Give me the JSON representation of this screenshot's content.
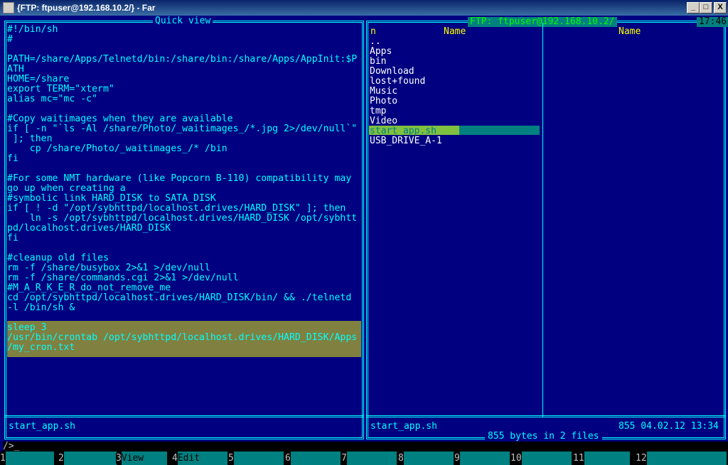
{
  "window": {
    "title": "{FTP: ftpuser@192.168.10.2/} - Far",
    "min": "_",
    "max": "□",
    "close": "X"
  },
  "left_panel": {
    "title": "Quick view",
    "content": "#!/bin/sh\n#\n\nPATH=/share/Apps/Telnetd/bin:/share/bin:/share/Apps/AppInit:$P\nATH\nHOME=/share\nexport TERM=\"xterm\"\nalias mc=\"mc -c\"\n\n#Copy waitimages when they are available\nif [ -n \"`ls -Al /share/Photo/_waitimages_/*.jpg 2>/dev/null`\"\n ]; then\n    cp /share/Photo/_waitimages_/* /bin\nfi\n\n#For some NMT hardware (like Popcorn B-110) compatibility may\ngo up when creating a\n#symbolic link HARD_DISK to SATA_DISK\nif [ ! -d \"/opt/sybhttpd/localhost.drives/HARD_DISK\" ]; then\n    ln -s /opt/sybhttpd/localhost.drives/HARD_DISK /opt/sybhtt\npd/localhost.drives/HARD_DISK\nfi\n\n#cleanup old files\nrm -f /share/busybox 2>&1 >/dev/null\nrm -f /share/commands.cgi 2>&1 >/dev/null\n#M_A_R_K_E_R_do_not_remove_me\ncd /opt/sybhttpd/localhost.drives/HARD_DISK/bin/ && ./telnetd\n-l /bin/sh &\n\nsleep 3\n/usr/bin/crontab /opt/sybhttpd/localhost.drives/HARD_DISK/Apps\n/my_cron.txt",
    "file_name": "start_app.sh"
  },
  "right_panel": {
    "title": "FTP: ftpuser@192.168.10.2/",
    "clock": "17:46",
    "sort_indicator": "n",
    "col1_header": "Name",
    "col2_header": "Name",
    "files": [
      "..",
      "Apps",
      "bin",
      "Download",
      "lost+found",
      "Music",
      "Photo",
      "tmp",
      "Video",
      "start_app.sh",
      "USB_DRIVE_A-1"
    ],
    "cursor_index": 9,
    "file_name": "start_app.sh",
    "file_info": "855 04.02.12 13:34",
    "summary": "855 bytes in 2 files"
  },
  "command_line": {
    "prompt": "/>"
  },
  "keybar": [
    {
      "num": "1",
      "label": ""
    },
    {
      "num": "2",
      "label": ""
    },
    {
      "num": "3",
      "label": "View"
    },
    {
      "num": "4",
      "label": "Edit"
    },
    {
      "num": "5",
      "label": ""
    },
    {
      "num": "6",
      "label": ""
    },
    {
      "num": "7",
      "label": ""
    },
    {
      "num": "8",
      "label": ""
    },
    {
      "num": "9",
      "label": ""
    },
    {
      "num": "10",
      "label": ""
    },
    {
      "num": "11",
      "label": ""
    },
    {
      "num": "12",
      "label": ""
    }
  ]
}
